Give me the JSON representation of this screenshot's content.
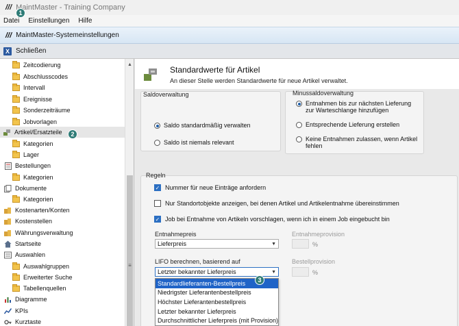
{
  "app": {
    "title": "MaintMaster - Training Company",
    "logo": "///"
  },
  "menu": {
    "items": [
      "Datei",
      "Einstellungen",
      "Hilfe"
    ]
  },
  "window": {
    "title": "MaintMaster-Systemeinstellungen"
  },
  "toolbar": {
    "close_label": "Schließen",
    "close_icon": "X"
  },
  "sidebar": {
    "items": [
      {
        "label": "Zeitcodierung",
        "icon": "folder-icon"
      },
      {
        "label": "Abschlusscodes",
        "icon": "folder-icon"
      },
      {
        "label": "Intervall",
        "icon": "folder-icon"
      },
      {
        "label": "Ereignisse",
        "icon": "folder-icon"
      },
      {
        "label": "Sonderzeiträume",
        "icon": "folder-icon"
      },
      {
        "label": "Jobvorlagen",
        "icon": "folder-icon"
      },
      {
        "label": "Artikel/Ersatzteile",
        "icon": "parts-icon"
      },
      {
        "label": "Kategorien",
        "icon": "folder-icon"
      },
      {
        "label": "Lager",
        "icon": "folder-icon"
      },
      {
        "label": "Bestellungen",
        "icon": "order-icon"
      },
      {
        "label": "Kategorien",
        "icon": "folder-icon"
      },
      {
        "label": "Dokumente",
        "icon": "document-icon"
      },
      {
        "label": "Kategorien",
        "icon": "folder-icon"
      },
      {
        "label": "Kostenarten/Konten",
        "icon": "cost-icon"
      },
      {
        "label": "Kostenstellen",
        "icon": "cost-icon"
      },
      {
        "label": "Währungsverwaltung",
        "icon": "cost-icon"
      },
      {
        "label": "Startseite",
        "icon": "home-icon"
      },
      {
        "label": "Auswahlen",
        "icon": "list-icon"
      },
      {
        "label": "Auswahlgruppen",
        "icon": "folder-icon"
      },
      {
        "label": "Erweiterter Suche",
        "icon": "folder-icon"
      },
      {
        "label": "Tabellenquellen",
        "icon": "folder-icon"
      },
      {
        "label": "Diagramme",
        "icon": "chart-icon"
      },
      {
        "label": "KPIs",
        "icon": "kpi-icon"
      },
      {
        "label": "Kurztaste",
        "icon": "key-icon"
      }
    ]
  },
  "header": {
    "title": "Standardwerte für Artikel",
    "subtitle": "An dieser Stelle werden Standardwerte für neue Artikel verwaltet."
  },
  "saldo": {
    "title": "Saldoverwaltung",
    "option1": "Saldo standardmäßig verwalten",
    "option2": "Saldo ist niemals relevant"
  },
  "minussaldo": {
    "title": "Minussaldoverwaltung",
    "option1_line1": "Entnahmen bis zur nächsten Lieferung",
    "option1_line2": "zur Warteschlange hinzufügen",
    "option2": "Entsprechende Lieferung erstellen",
    "option3_line1": "Keine Entnahmen zulassen, wenn Artikel",
    "option3_line2": "fehlen"
  },
  "regeln": {
    "title": "Regeln",
    "check1": "Nummer für neue Einträge anfordern",
    "check2": "Nur Standortobjekte anzeigen, bei denen Artikel und Artikelentnahme übereinstimmen",
    "check3": "Job bei Entnahme von Artikeln vorschlagen, wenn ich in einem Job eingebucht bin",
    "entnahmepreis_label": "Entnahmepreis",
    "entnahmepreis_value": "Lieferpreis",
    "entnahmeprovision_label": "Entnahmeprovision",
    "percent": "%",
    "lifo_label": "LIFO berechnen, basierend auf",
    "lifo_value": "Letzter bekannter Lieferpreis",
    "bestellprovision_label": "Bestellprovision"
  },
  "dropdown": {
    "options": [
      "Standardlieferanten-Bestellpreis",
      "Niedrigster Lieferantenbestellpreis",
      "Höchster Lieferantenbestellpreis",
      "Letzter bekannter Lieferpreis",
      "Durchschnittlicher Lieferpreis (mit Provision)"
    ]
  },
  "badges": [
    "1",
    "2",
    "3"
  ],
  "colors": {
    "accent": "#1f63c7",
    "badge": "#2f7c77",
    "folder": "#f2c44d"
  }
}
